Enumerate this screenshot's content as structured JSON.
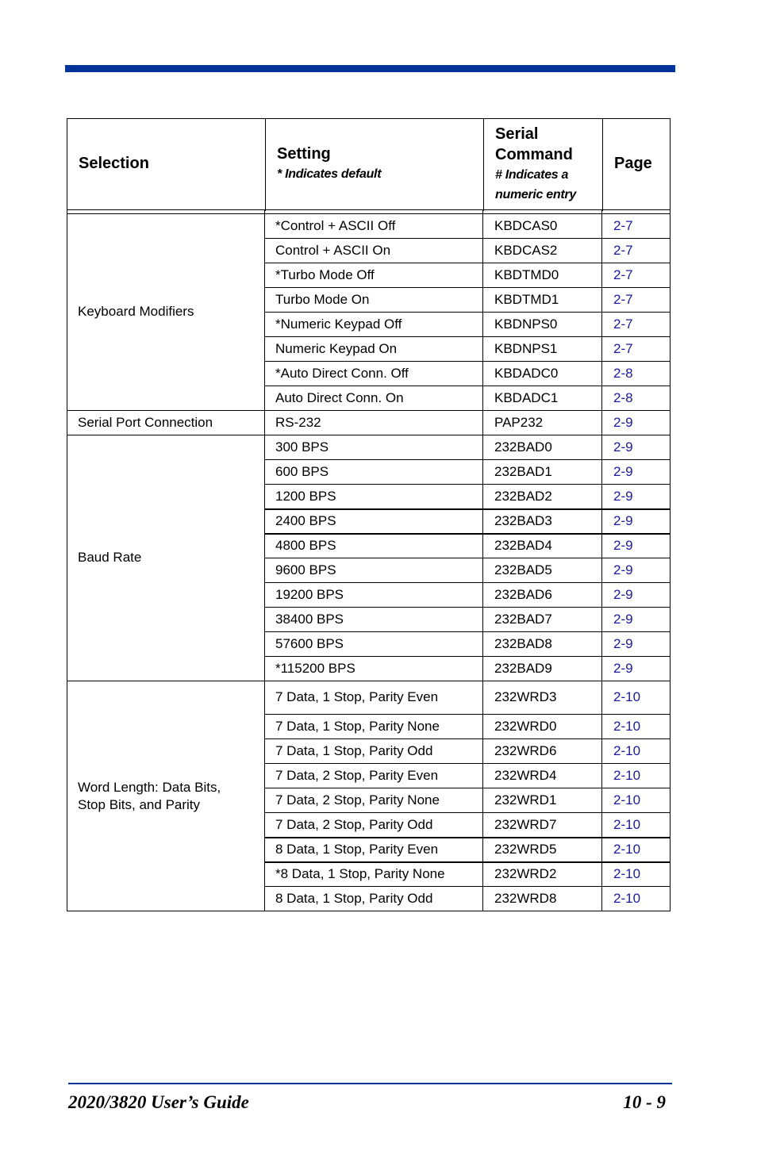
{
  "header": {
    "selection": "Selection",
    "setting": "Setting",
    "setting_note": "* Indicates default",
    "serial_command_line1": "Serial",
    "serial_command_line2": "Command",
    "serial_note_line1": "# Indicates a",
    "serial_note_line2": "numeric entry",
    "page": "Page"
  },
  "groups": [
    {
      "selection": "Keyboard Modifiers",
      "rows": [
        {
          "setting": "*Control + ASCII Off",
          "command": "KBDCAS0",
          "page": "2-7"
        },
        {
          "setting": "Control + ASCII On",
          "command": "KBDCAS2",
          "page": "2-7"
        },
        {
          "setting": "*Turbo Mode Off",
          "command": "KBDTMD0",
          "page": "2-7"
        },
        {
          "setting": "Turbo Mode On",
          "command": "KBDTMD1",
          "page": "2-7"
        },
        {
          "setting": "*Numeric Keypad Off",
          "command": "KBDNPS0",
          "page": "2-7"
        },
        {
          "setting": "Numeric Keypad On",
          "command": "KBDNPS1",
          "page": "2-7"
        },
        {
          "setting": "*Auto Direct Conn. Off",
          "command": "KBDADC0",
          "page": "2-8"
        },
        {
          "setting": "Auto Direct Conn. On",
          "command": "KBDADC1",
          "page": "2-8"
        }
      ]
    },
    {
      "selection": "Serial Port Connection",
      "rows": [
        {
          "setting": "RS-232",
          "command": "PAP232",
          "page": "2-9"
        }
      ]
    },
    {
      "selection": "Baud Rate",
      "rows": [
        {
          "setting": "300 BPS",
          "command": "232BAD0",
          "page": "2-9"
        },
        {
          "setting": "600 BPS",
          "command": "232BAD1",
          "page": "2-9"
        },
        {
          "setting": "1200 BPS",
          "command": "232BAD2",
          "page": "2-9"
        },
        {
          "setting": "2400 BPS",
          "command": "232BAD3",
          "page": "2-9"
        },
        {
          "setting": "4800 BPS",
          "command": "232BAD4",
          "page": "2-9"
        },
        {
          "setting": "9600 BPS",
          "command": "232BAD5",
          "page": "2-9"
        },
        {
          "setting": "19200 BPS",
          "command": "232BAD6",
          "page": "2-9"
        },
        {
          "setting": "38400 BPS",
          "command": "232BAD7",
          "page": "2-9"
        },
        {
          "setting": "57600 BPS",
          "command": "232BAD8",
          "page": "2-9"
        },
        {
          "setting": "*115200 BPS",
          "command": "232BAD9",
          "page": "2-9"
        }
      ]
    },
    {
      "selection": "Word Length:  Data Bits, Stop Bits, and Parity",
      "selection_line1": "Word Length:  Data Bits,",
      "selection_line2": "Stop Bits, and Parity",
      "rows": [
        {
          "setting": "7 Data, 1 Stop, Parity Even",
          "command": "232WRD3",
          "page": "2-10"
        },
        {
          "setting": "7 Data, 1 Stop, Parity None",
          "command": "232WRD0",
          "page": "2-10"
        },
        {
          "setting": "7 Data, 1 Stop, Parity Odd",
          "command": "232WRD6",
          "page": "2-10"
        },
        {
          "setting": "7 Data, 2 Stop, Parity Even",
          "command": "232WRD4",
          "page": "2-10"
        },
        {
          "setting": "7 Data, 2 Stop, Parity None",
          "command": "232WRD1",
          "page": "2-10"
        },
        {
          "setting": "7 Data, 2 Stop, Parity Odd",
          "command": "232WRD7",
          "page": "2-10"
        },
        {
          "setting": "8 Data, 1 Stop, Parity Even",
          "command": "232WRD5",
          "page": "2-10"
        },
        {
          "setting": "*8 Data, 1 Stop, Parity None",
          "command": "232WRD2",
          "page": "2-10"
        },
        {
          "setting": "8 Data, 1 Stop, Parity Odd",
          "command": "232WRD8",
          "page": "2-10"
        }
      ]
    }
  ],
  "footer": {
    "title": "2020/3820 User’s Guide",
    "page_number": "10 - 9"
  },
  "colors": {
    "accent": "#003399",
    "link": "#1a1aa6"
  }
}
